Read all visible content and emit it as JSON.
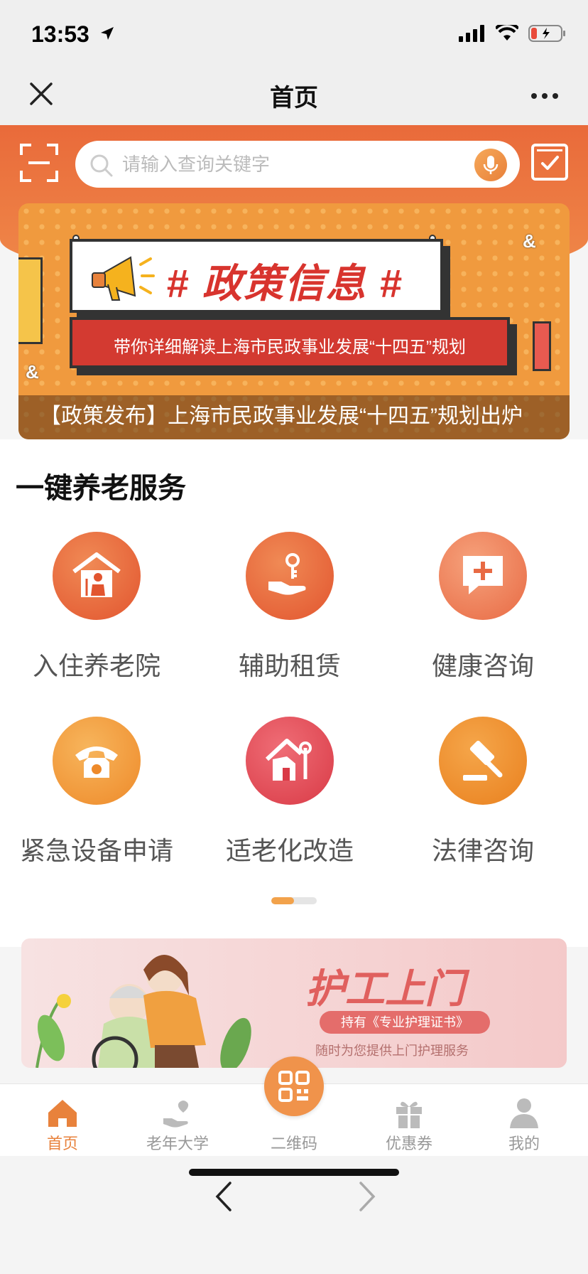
{
  "status_bar": {
    "time": "13:53"
  },
  "window": {
    "title": "首页"
  },
  "search": {
    "placeholder": "请输入查询关键字"
  },
  "banner": {
    "headline": "# 政策信息 #",
    "subline": "带你详细解读上海市民政事业发展“十四五”规划",
    "caption": "【政策发布】上海市民政事业发展“十四五”规划出炉"
  },
  "services": {
    "title": "一键养老服务",
    "items": [
      {
        "label": "入住养老院",
        "icon": "nursing-home-icon",
        "color": "#e8623a"
      },
      {
        "label": "辅助租赁",
        "icon": "rental-hand-icon",
        "color": "#e8623a"
      },
      {
        "label": "健康咨询",
        "icon": "health-chat-icon",
        "color": "#ee7f55"
      },
      {
        "label": "紧急设备申请",
        "icon": "telephone-icon",
        "color": "#f29a3c"
      },
      {
        "label": "适老化改造",
        "icon": "house-tools-icon",
        "color": "#e0454f"
      },
      {
        "label": "法律咨询",
        "icon": "gavel-icon",
        "color": "#ef8a2e"
      }
    ],
    "pager": {
      "pages": 2,
      "current": 1
    }
  },
  "care_banner": {
    "title": "护工上门",
    "pill": "持有《专业护理证书》",
    "subtitle": "随时为您提供上门护理服务"
  },
  "tabbar": {
    "items": [
      {
        "label": "首页",
        "icon": "home-icon",
        "active": true
      },
      {
        "label": "老年大学",
        "icon": "heart-hand-icon",
        "active": false
      },
      {
        "label": "二维码",
        "icon": "qr-code-icon",
        "active": false
      },
      {
        "label": "优惠券",
        "icon": "gift-icon",
        "active": false
      },
      {
        "label": "我的",
        "icon": "person-icon",
        "active": false
      }
    ]
  },
  "colors": {
    "accent": "#e8823c",
    "header": "#ec7540"
  }
}
